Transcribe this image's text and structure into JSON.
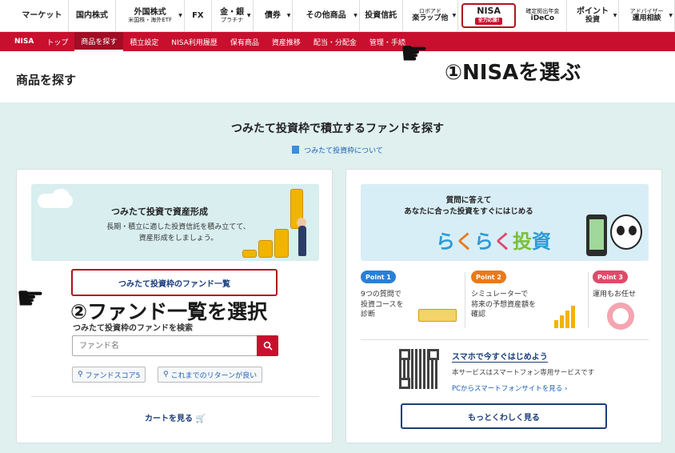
{
  "topnav": {
    "items": [
      {
        "label": "マーケット",
        "sub": "",
        "caret": false
      },
      {
        "label": "国内株式",
        "sub": "",
        "caret": false
      },
      {
        "label": "外国株式",
        "sub": "米国株・海外ETF",
        "caret": true
      },
      {
        "label": "FX",
        "sub": "",
        "caret": false
      },
      {
        "label": "金・銀",
        "sub": "プラチナ",
        "caret": true
      },
      {
        "label": "債券",
        "sub": "",
        "caret": true
      },
      {
        "label": "その他商品",
        "sub": "",
        "caret": true
      },
      {
        "label": "投資信託",
        "sub": "",
        "caret": false
      },
      {
        "label": "ロボアド",
        "sub": "楽ラップ他",
        "caret": true
      },
      {
        "label": "NISA",
        "sub": "全力応援!",
        "caret": false
      },
      {
        "label": "確定拠出年金",
        "sub": "iDeCo",
        "caret": false
      },
      {
        "label": "ポイント",
        "sub": "投資",
        "caret": true
      },
      {
        "label": "アドバイザー",
        "sub": "運用相談",
        "caret": true
      }
    ]
  },
  "subnav": {
    "items": [
      "NISA",
      "トップ",
      "商品を探す",
      "積立設定",
      "NISA利用履歴",
      "保有商品",
      "資産推移",
      "配当・分配金",
      "管理・手続"
    ],
    "active_index": 2
  },
  "page": {
    "title": "商品を探す",
    "band_title": "つみたて投資枠で積立するファンドを探す",
    "band_link": "つみたて投資枠について"
  },
  "left_card": {
    "banner_title": "つみたて投資で資産形成",
    "banner_text_1": "長期・積立に適した投資信託を積み立てて、",
    "banner_text_2": "資産形成をしましょう。",
    "fund_list_button": "つみたて投資枠のファンド一覧",
    "search_label": "つみたて投資枠のファンドを検索",
    "search_placeholder": "ファンド名",
    "tags": [
      "ファンドスコア5",
      "これまでのリターンが良い"
    ],
    "cart_link": "カートを見る"
  },
  "right_card": {
    "banner_line1": "質問に答えて",
    "banner_line2": "あなたに合った投資をすぐにはじめる",
    "banner_logo": "らくらく投資",
    "points": [
      {
        "badge": "Point 1",
        "text": [
          "9つの質問で",
          "投資コースを",
          "診断"
        ],
        "color": "#2a7fd4"
      },
      {
        "badge": "Point 2",
        "text": [
          "シミュレーターで",
          "将来の予想資産額を",
          "確認"
        ],
        "color": "#e87a1a"
      },
      {
        "badge": "Point 3",
        "text": [
          "運用もお任せ"
        ],
        "color": "#e04a6a"
      }
    ],
    "smartphone_title": "スマホで今すぐはじめよう",
    "smartphone_text": "本サービスはスマートフォン専用サービスです",
    "smartphone_link": "PCからスマートフォンサイトを見る",
    "more_button": "もっとくわしく見る"
  },
  "annotations": {
    "step1": "①NISAを選ぶ",
    "step2": "②ファンド一覧を選択"
  },
  "colors": {
    "brand_red": "#c8102e",
    "nav_blue": "#1a3d7c",
    "band_teal": "#dff0ef"
  }
}
